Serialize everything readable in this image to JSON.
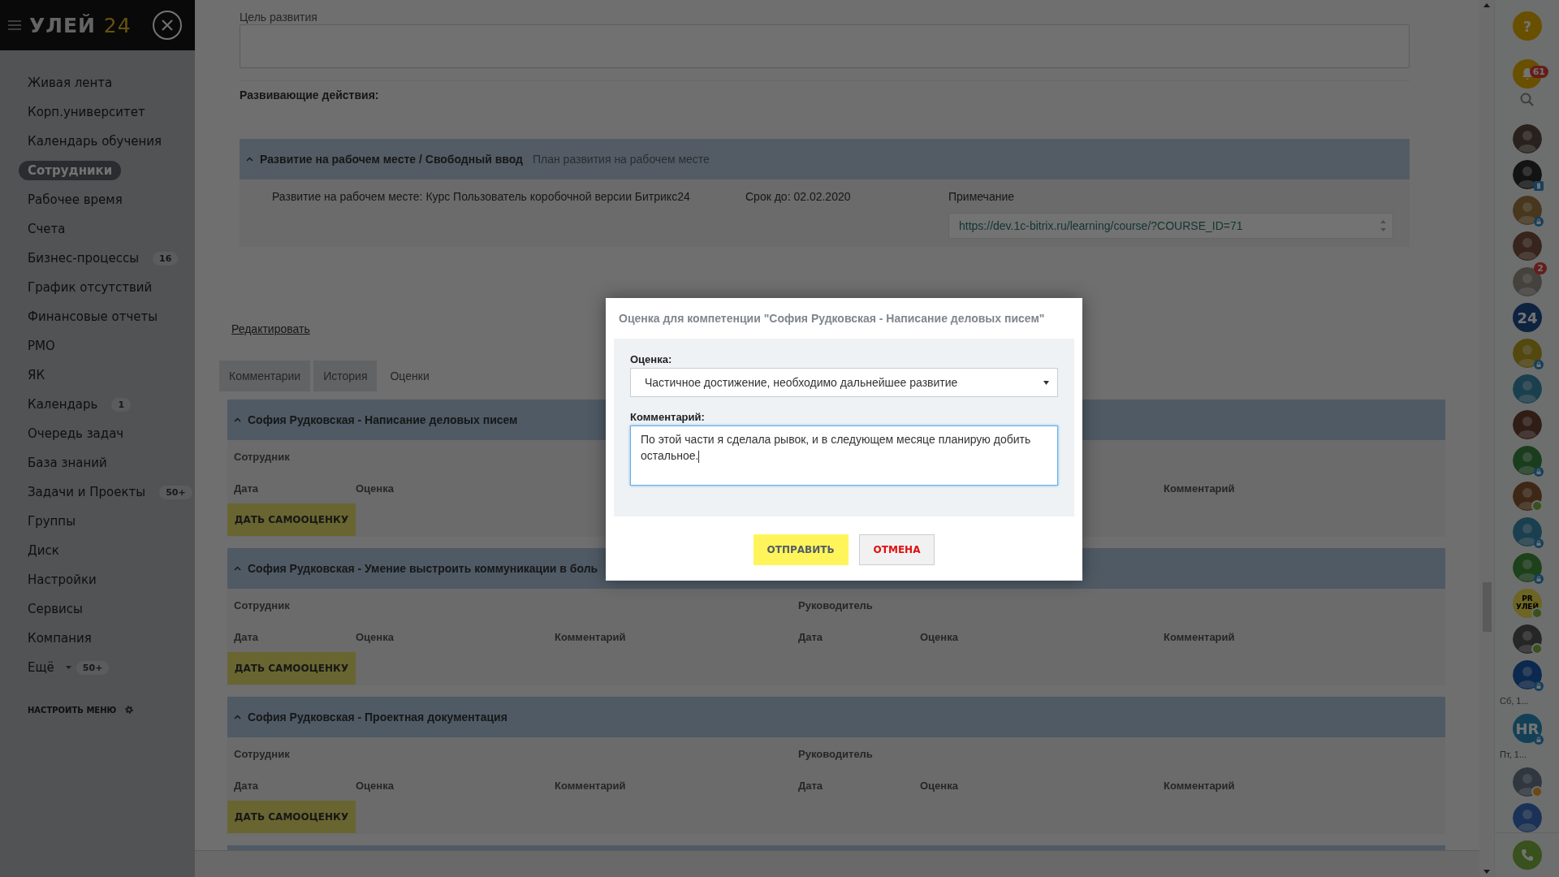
{
  "logo": {
    "name": "УЛЕЙ",
    "number": "24"
  },
  "sidebar": {
    "items": [
      {
        "label": "Живая лента",
        "selected": false
      },
      {
        "label": "Корп.университет",
        "selected": false
      },
      {
        "label": "Календарь обучения",
        "selected": false
      },
      {
        "label": "Сотрудники",
        "selected": true
      },
      {
        "label": "Рабочее время",
        "selected": false
      },
      {
        "label": "Счета",
        "selected": false
      },
      {
        "label": "Бизнес-процессы",
        "counter": "16",
        "selected": false
      },
      {
        "label": "График отсутствий",
        "selected": false
      },
      {
        "label": "Финансовые отчеты",
        "selected": false
      },
      {
        "label": "РМО",
        "selected": false
      },
      {
        "label": "ЯК",
        "selected": false
      },
      {
        "label": "Календарь",
        "counter": "1",
        "selected": false
      },
      {
        "label": "Очередь задач",
        "selected": false
      },
      {
        "label": "База знаний",
        "selected": false
      },
      {
        "label": "Задачи и Проекты",
        "counter": "50+",
        "selected": false
      },
      {
        "label": "Группы",
        "selected": false
      },
      {
        "label": "Диск",
        "selected": false
      },
      {
        "label": "Настройки",
        "selected": false
      },
      {
        "label": "Сервисы",
        "selected": false
      },
      {
        "label": "Компания",
        "selected": false
      },
      {
        "label": "Ещё",
        "counter": "50+",
        "selected": false,
        "kind": "more"
      }
    ],
    "settings": "НАСТРОИТЬ МЕНЮ"
  },
  "plan": {
    "goal_label": "Цель развития",
    "actions_label": "Развивающие действия:",
    "group": {
      "title": "Развитие на рабочем месте / Свободный ввод",
      "subtitle": "План развития на рабочем месте",
      "expanded": true,
      "item": {
        "text": "Развитие на рабочем месте: Курс Пользователь коробочной версии Битрикс24",
        "deadline": "Срок до: 02.02.2020",
        "note_label": "Примечание",
        "note_value": "https://dev.1c-bitrix.ru/learning/course/?COURSE_ID=71"
      }
    }
  },
  "edit_link": "Редактировать",
  "tabs": [
    {
      "label": "Комментарии",
      "selected": false
    },
    {
      "label": "История",
      "selected": false
    },
    {
      "label": "Оценки",
      "selected": true
    }
  ],
  "competencies": [
    {
      "title": "София Рудковская - Написание деловых писем",
      "expanded": true,
      "employee_label": "Сотрудник",
      "columns": [
        "Дата",
        "Оценка",
        null,
        null,
        null,
        "Комментарий"
      ],
      "button": "ДАТЬ САМООЦЕНКУ"
    },
    {
      "title": "София Рудковская - Умение выстроить коммуникации в боль",
      "expanded": true,
      "employee_label": "Сотрудник",
      "manager_label": "Руководитель",
      "columns": [
        "Дата",
        "Оценка",
        "Комментарий",
        "Дата",
        "Оценка",
        "Комментарий"
      ],
      "button": "ДАТЬ САМООЦЕНКУ"
    },
    {
      "title": "София Рудковская - Проектная документация",
      "expanded": true,
      "employee_label": "Сотрудник",
      "manager_label": "Руководитель",
      "columns": [
        "Дата",
        "Оценка",
        "Комментарий",
        "Дата",
        "Оценка",
        "Комментарий"
      ],
      "button": "ДАТЬ САМООЦЕНКУ"
    }
  ],
  "modal": {
    "title": "Оценка для компетенции \"София Рудковская - Написание деловых писем\"",
    "rating_label": "Оценка:",
    "rating_value": "Частичное достижение, необходимо дальнейшее развитие",
    "comment_label": "Комментарий:",
    "comment_value": "По этой части я сделала рывок, и в следующем месяце планирую добить остальное.",
    "buttons": [
      {
        "label": "ОТПРАВИТЬ",
        "kind": "primary"
      },
      {
        "label": "ОТМЕНА",
        "kind": "cancel"
      }
    ]
  },
  "right_panel": {
    "items": [
      {
        "kind": "help",
        "label": "?"
      },
      {
        "kind": "notifications",
        "badge": "61"
      },
      {
        "kind": "search"
      },
      {
        "kind": "avatar"
      },
      {
        "kind": "avatar",
        "mobile": true
      },
      {
        "kind": "avatar",
        "locked": true
      },
      {
        "kind": "avatar"
      },
      {
        "kind": "avatar",
        "badge": "2"
      },
      {
        "kind": "avatar",
        "label": "24"
      },
      {
        "kind": "avatar",
        "locked": true
      },
      {
        "kind": "avatar"
      },
      {
        "kind": "avatar"
      },
      {
        "kind": "avatar",
        "locked": true
      },
      {
        "kind": "avatar",
        "online": true
      },
      {
        "kind": "avatar",
        "locked": true
      },
      {
        "kind": "avatar",
        "locked": true
      },
      {
        "kind": "avatar",
        "label": "PR УЛЕЙ",
        "online": true
      },
      {
        "kind": "avatar",
        "online": true
      },
      {
        "kind": "avatar",
        "locked": true
      },
      {
        "kind": "date",
        "label": "Сб, 1..."
      },
      {
        "kind": "avatar",
        "label": "HR",
        "locked": true
      },
      {
        "kind": "date",
        "label": "Пт, 1..."
      },
      {
        "kind": "avatar",
        "away": true
      },
      {
        "kind": "avatar"
      }
    ],
    "call": {
      "kind": "phone"
    }
  }
}
